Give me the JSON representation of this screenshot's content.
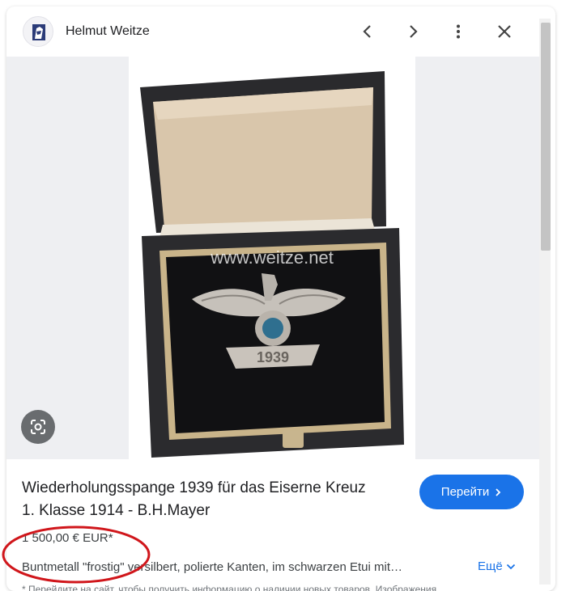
{
  "header": {
    "site_name": "Helmut Weitze",
    "logo_icon": "weitze-logo-icon",
    "prev_icon": "chevron-left-icon",
    "next_icon": "chevron-right-icon",
    "menu_icon": "more-vert-icon",
    "close_icon": "close-icon"
  },
  "image": {
    "watermark": "www.weitze.net",
    "badge_text": "1939",
    "lens_icon": "google-lens-icon"
  },
  "product": {
    "title_line1": "Wiederholungsspange 1939 für das Eiserne Kreuz",
    "title_line2": "1. Klasse 1914 - B.H.Mayer",
    "price": "1 500,00 € EUR*",
    "description": "Buntmetall \"frostig\" versilbert, polierte Kanten, im schwarzen Etui mit…",
    "more_label": "Ещё",
    "go_button_label": "Перейти",
    "disclaimer": "* Перейдите на сайт, чтобы получить информацию о наличии новых товаров. Изображения"
  },
  "colors": {
    "accent": "#1a73e8",
    "annotation": "#d0161b"
  }
}
